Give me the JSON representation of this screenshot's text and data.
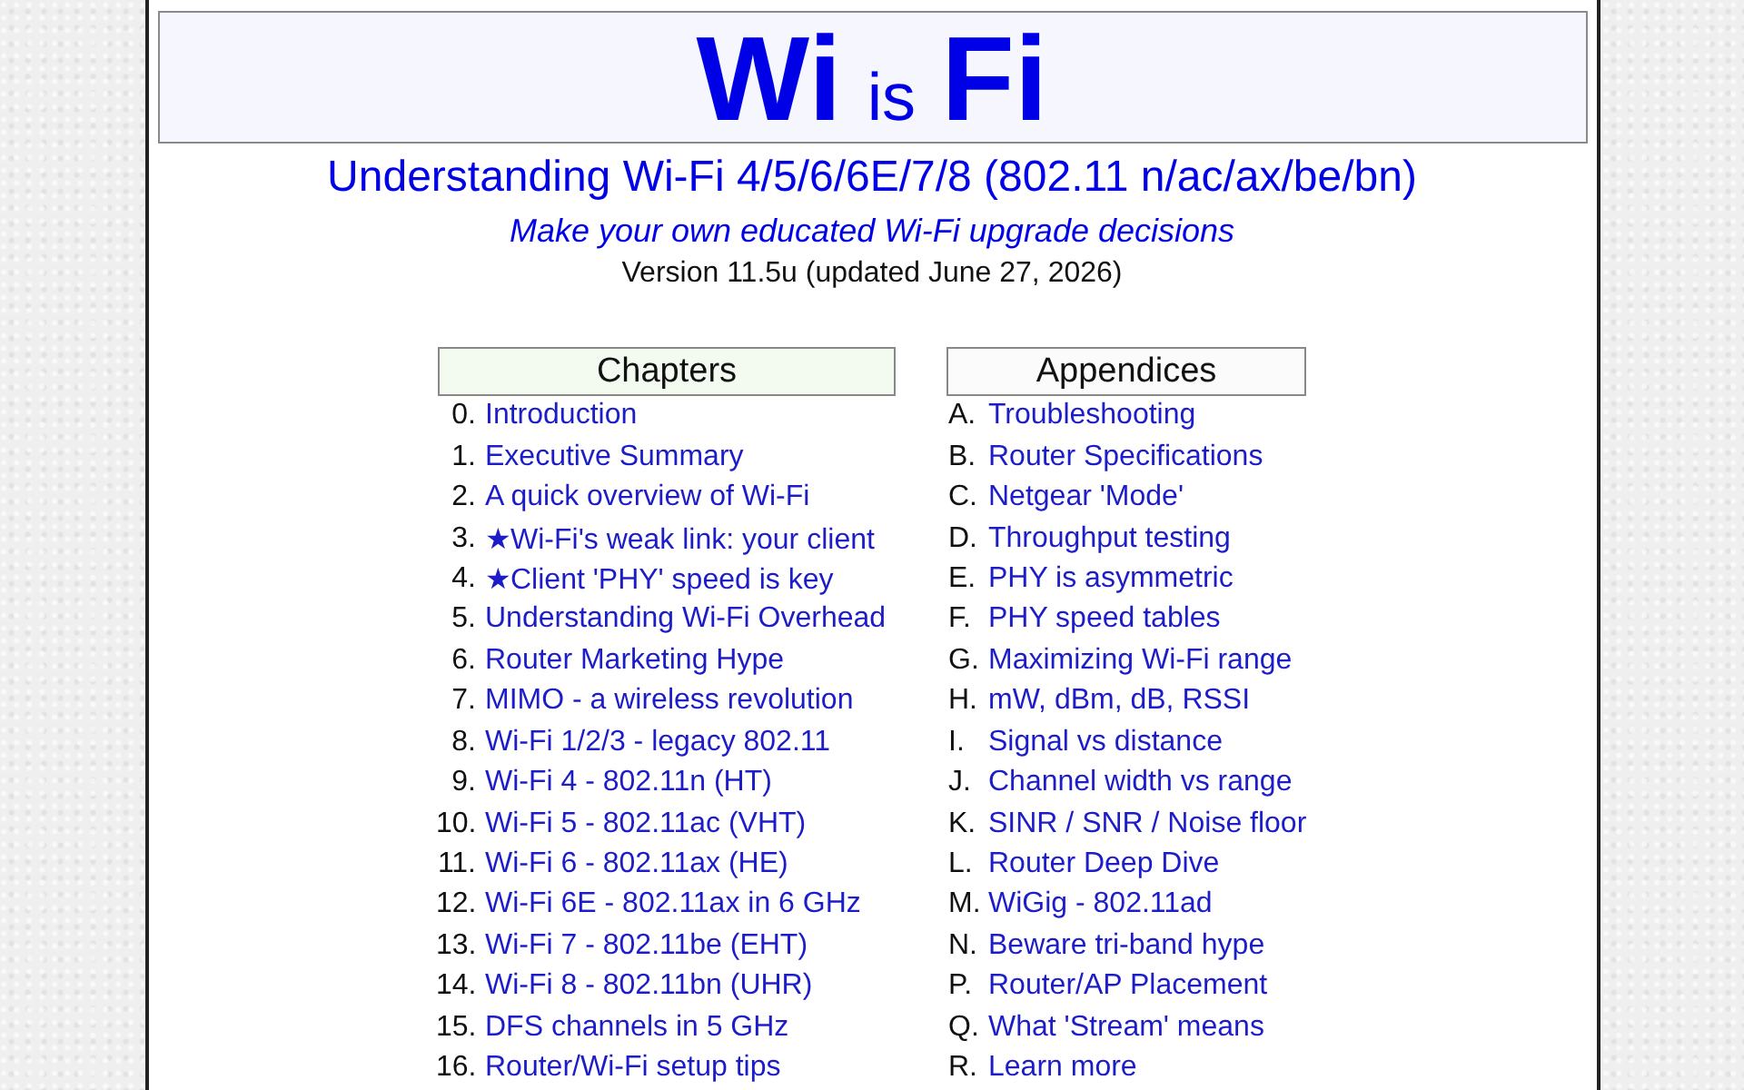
{
  "header": {
    "logo": [
      {
        "text": "Wi",
        "kind": "large"
      },
      {
        "text": "is",
        "kind": "small"
      },
      {
        "text": "Fi",
        "kind": "large"
      }
    ],
    "subtitle": "Understanding Wi-Fi 4/5/6/6E/7/8 (802.11 n/ac/ax/be/bn)",
    "tagline": "Make your own educated Wi-Fi upgrade decisions",
    "version": "Version 11.5u (updated June 27, 2026)"
  },
  "chapters": {
    "heading": "Chapters",
    "items": [
      {
        "marker": "0.",
        "title": "Introduction"
      },
      {
        "marker": "1.",
        "title": "Executive Summary"
      },
      {
        "marker": "2.",
        "title": "A quick overview of Wi-Fi"
      },
      {
        "marker": "3.",
        "title": "★Wi-Fi's weak link: your client"
      },
      {
        "marker": "4.",
        "title": "★Client 'PHY' speed is key"
      },
      {
        "marker": "5.",
        "title": "Understanding Wi-Fi Overhead"
      },
      {
        "marker": "6.",
        "title": "Router Marketing Hype"
      },
      {
        "marker": "7.",
        "title": "MIMO - a wireless revolution"
      },
      {
        "marker": "8.",
        "title": "Wi-Fi 1/2/3 - legacy 802.11"
      },
      {
        "marker": "9.",
        "title": "Wi-Fi 4 - 802.11n (HT)"
      },
      {
        "marker": "10.",
        "title": "Wi-Fi 5 - 802.11ac (VHT)"
      },
      {
        "marker": "11.",
        "title": "Wi-Fi 6 - 802.11ax (HE)"
      },
      {
        "marker": "12.",
        "title": "Wi-Fi 6E - 802.11ax in 6 GHz"
      },
      {
        "marker": "13.",
        "title": "Wi-Fi 7 - 802.11be (EHT)"
      },
      {
        "marker": "14.",
        "title": "Wi-Fi 8 - 802.11bn (UHR)"
      },
      {
        "marker": "15.",
        "title": "DFS channels in 5 GHz"
      },
      {
        "marker": "16.",
        "title": "Router/Wi-Fi setup tips"
      }
    ]
  },
  "appendices": {
    "heading": "Appendices",
    "items": [
      {
        "marker": "A.",
        "title": "Troubleshooting"
      },
      {
        "marker": "B.",
        "title": "Router Specifications"
      },
      {
        "marker": "C.",
        "title": "Netgear 'Mode'"
      },
      {
        "marker": "D.",
        "title": "Throughput testing"
      },
      {
        "marker": "E.",
        "title": "PHY is asymmetric"
      },
      {
        "marker": "F.",
        "title": "PHY speed tables"
      },
      {
        "marker": "G.",
        "title": "Maximizing Wi-Fi range"
      },
      {
        "marker": "H.",
        "title": "mW, dBm, dB, RSSI"
      },
      {
        "marker": "I.",
        "title": "Signal vs distance"
      },
      {
        "marker": "J.",
        "title": "Channel width vs range"
      },
      {
        "marker": "K.",
        "title": "SINR / SNR / Noise floor"
      },
      {
        "marker": "L.",
        "title": "Router Deep Dive"
      },
      {
        "marker": "M.",
        "title": "WiGig - 802.11ad"
      },
      {
        "marker": "N.",
        "title": "Beware tri-band hype"
      },
      {
        "marker": "P.",
        "title": "Router/AP Placement"
      },
      {
        "marker": "Q.",
        "title": "What 'Stream' means"
      },
      {
        "marker": "R.",
        "title": "Learn more"
      }
    ]
  }
}
